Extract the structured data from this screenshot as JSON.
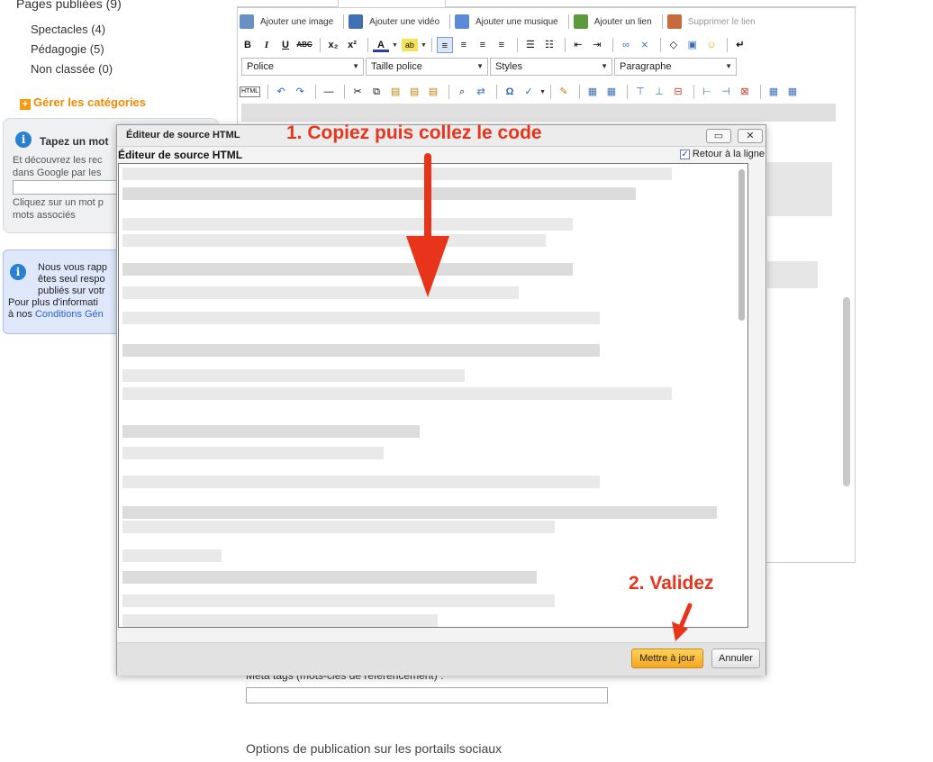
{
  "sidebar": {
    "title": "Pages publiées (9)",
    "categories": [
      {
        "label": "Spectacles (4)"
      },
      {
        "label": "Pédagogie (5)"
      },
      {
        "label": "Non classée (0)"
      }
    ],
    "manage_categories": "Gérer les catégories",
    "keyword_box": {
      "title": "Tapez un mot",
      "line1": "Et découvrez les rec",
      "line2": "dans Google par les",
      "line3": "Cliquez sur un mot p",
      "line4": "mots associés"
    },
    "notice": {
      "line1": "Nous vous rapp",
      "line2": "êtes seul respo",
      "line3": "publiés sur votr",
      "line4": "Pour plus d'informati",
      "line5_prefix": "à nos ",
      "link": "Conditions Gén"
    }
  },
  "editor": {
    "media_buttons": [
      {
        "label": "Ajouter une image",
        "icon": "image-icon"
      },
      {
        "label": "Ajouter une vidéo",
        "icon": "video-icon"
      },
      {
        "label": "Ajouter une musique",
        "icon": "music-icon"
      },
      {
        "label": "Ajouter un lien",
        "icon": "link-icon"
      },
      {
        "label": "Supprimer le lien",
        "icon": "unlink-icon"
      }
    ],
    "format_buttons": [
      "B",
      "I",
      "U",
      "ABC",
      "x₂",
      "x²",
      "A",
      "ab"
    ],
    "selects": {
      "font": "Police",
      "size": "Taille police",
      "styles": "Styles",
      "paragraph": "Paragraphe"
    },
    "html_button": "HTML",
    "meta_tags_label": "Méta tags (mots-clés de référencement) :",
    "options_title": "Options de publication sur les portails sociaux"
  },
  "dialog": {
    "window_title": "Éditeur de source HTML",
    "subtitle": "Éditeur de source HTML",
    "wrap_label": "Retour à la ligne",
    "wrap_checked": "✓",
    "update_button": "Mettre à jour",
    "cancel_button": "Annuler"
  },
  "annotations": {
    "step1": "1. Copiez puis collez le code",
    "step2": "2. Validez",
    "color": "#e8341b"
  }
}
